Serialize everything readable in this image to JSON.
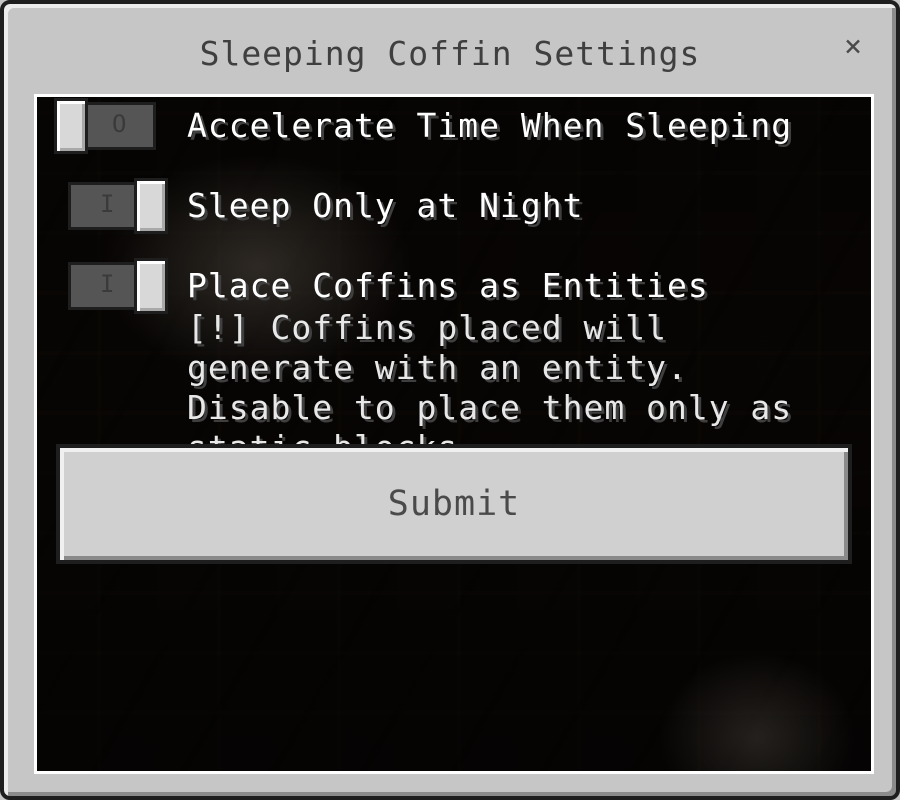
{
  "window": {
    "title": "Sleeping Coffin Settings",
    "close_glyph": "×"
  },
  "settings": [
    {
      "label": "Accelerate Time When Sleeping",
      "state": "off",
      "state_glyph": "O"
    },
    {
      "label": "Sleep Only at Night",
      "state": "on",
      "state_glyph": "I"
    },
    {
      "label": "Place Coffins as Entities",
      "state": "on",
      "state_glyph": "I",
      "description": "[!] Coffins placed will generate with an entity. Disable to place them only as static blocks."
    }
  ],
  "submit_label": "Submit",
  "icons": {
    "close": "close-icon"
  },
  "colors": {
    "window_bg": "#c6c6c6",
    "text_light": "#ffffff",
    "text_dark": "#3f3f3f"
  }
}
